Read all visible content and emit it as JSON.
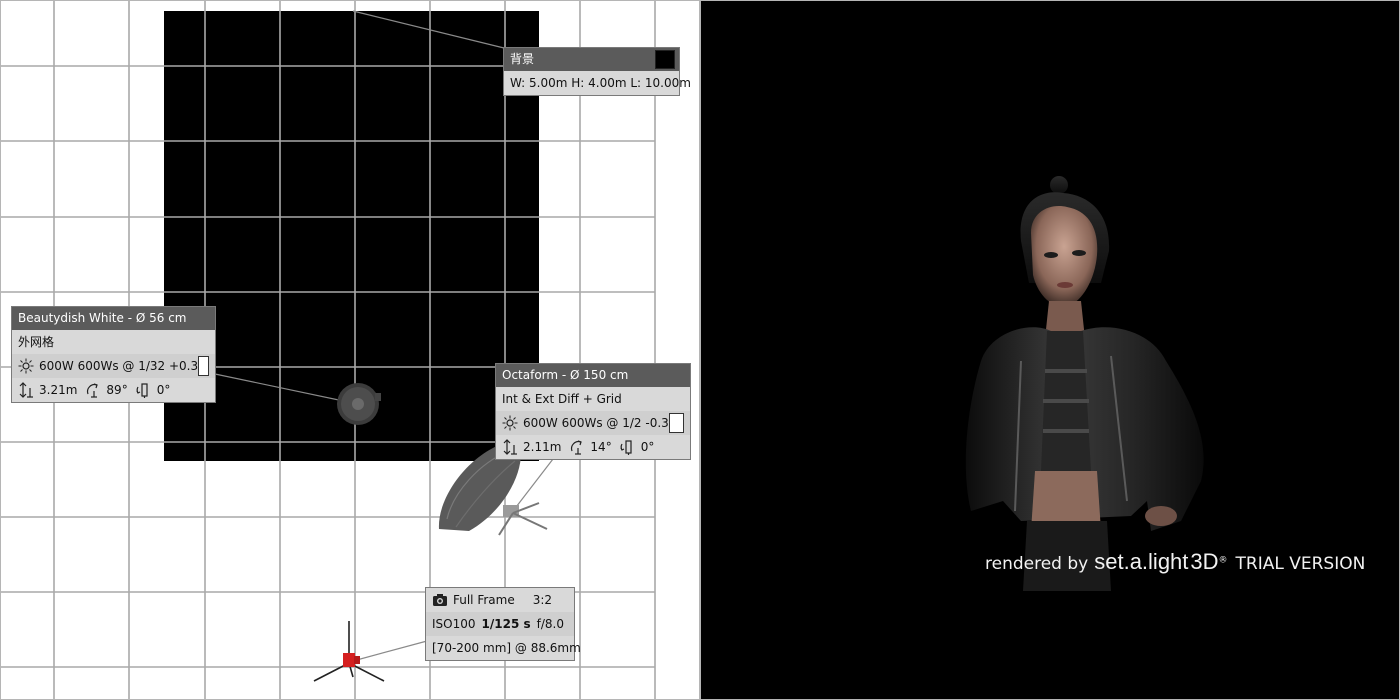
{
  "plan": {
    "background_panel": {
      "title": "背景",
      "color": "#000000",
      "dimensions": "W: 5.00m  H: 4.00m  L: 10.00m"
    },
    "beautydish_panel": {
      "title": "Beautydish White - Ø 56 cm",
      "accessory": "外网格",
      "power": "600W 600Ws @ 1/32 +0.3",
      "height": "3.21m",
      "tilt": "89°",
      "rotation": "0°",
      "light_color": "#ffffff"
    },
    "octaform_panel": {
      "title": "Octaform - Ø 150 cm",
      "accessory": "Int & Ext Diff + Grid",
      "power": "600W 600Ws @ 1/2 -0.3",
      "height": "2.11m",
      "tilt": "14°",
      "rotation": "0°",
      "light_color": "#ffffff"
    },
    "camera_panel": {
      "sensor": "Full Frame",
      "ratio": "3:2",
      "iso": "ISO100",
      "shutter": "1/125 s",
      "aperture": "f/8.0",
      "lens": "[70-200 mm] @ 88.6mm"
    },
    "icons": {
      "power": "sun-icon",
      "height": "height-icon",
      "tilt": "tilt-icon",
      "rotation": "rotation-icon",
      "camera": "camera-icon"
    },
    "colors": {
      "grid": "#a9a9a9",
      "backdrop": "#000000",
      "camera": "#d42020"
    }
  },
  "render": {
    "watermark_prefix": "rendered by",
    "watermark_brand": "set.a.light",
    "watermark_brand_suffix": "3D",
    "watermark_registered": "®",
    "watermark_trial": "TRIAL VERSION"
  }
}
